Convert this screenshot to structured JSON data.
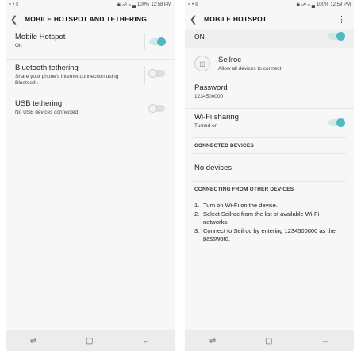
{
  "left": {
    "status": {
      "left_icons": "≈ • ≡",
      "right_icons": "✱ ☍ ≈ ▄",
      "battery": "100%",
      "time": "12:58 PM"
    },
    "title": "MOBILE HOTSPOT AND TETHERING",
    "items": [
      {
        "label": "Mobile Hotspot",
        "sub": "On",
        "toggle": "on"
      },
      {
        "label": "Bluetooth tethering",
        "sub": "Share your phone's internet connection using Bluetooth.",
        "toggle": "off"
      },
      {
        "label": "USB tethering",
        "sub": "No USB devices connected.",
        "toggle": "off"
      }
    ]
  },
  "right": {
    "status": {
      "left_icons": "≈ • ≡",
      "right_icons": "✱ ☍ ≈ ▄",
      "battery": "100%",
      "time": "12:59 PM"
    },
    "title": "MOBILE HOTSPOT",
    "on_label": "ON",
    "network": {
      "name": "Seilroc",
      "sub": "Allow all devices to connect."
    },
    "password": {
      "label": "Password",
      "value": "1234500000"
    },
    "wifi_sharing": {
      "label": "Wi-Fi sharing",
      "sub": "Turned on"
    },
    "connected_header": "CONNECTED DEVICES",
    "no_devices": "No devices",
    "connecting_header": "CONNECTING FROM OTHER DEVICES",
    "steps": [
      {
        "n": "1.",
        "text": "Turn on Wi-Fi on the device."
      },
      {
        "n": "2.",
        "text": "Select Seilroc from the list of available Wi-Fi networks."
      },
      {
        "n": "3.",
        "text": "Connect to Seilroc by entering 1234500000 as the password."
      }
    ]
  },
  "nav": {
    "recents": "⇌",
    "home": "▢",
    "back": "←"
  }
}
